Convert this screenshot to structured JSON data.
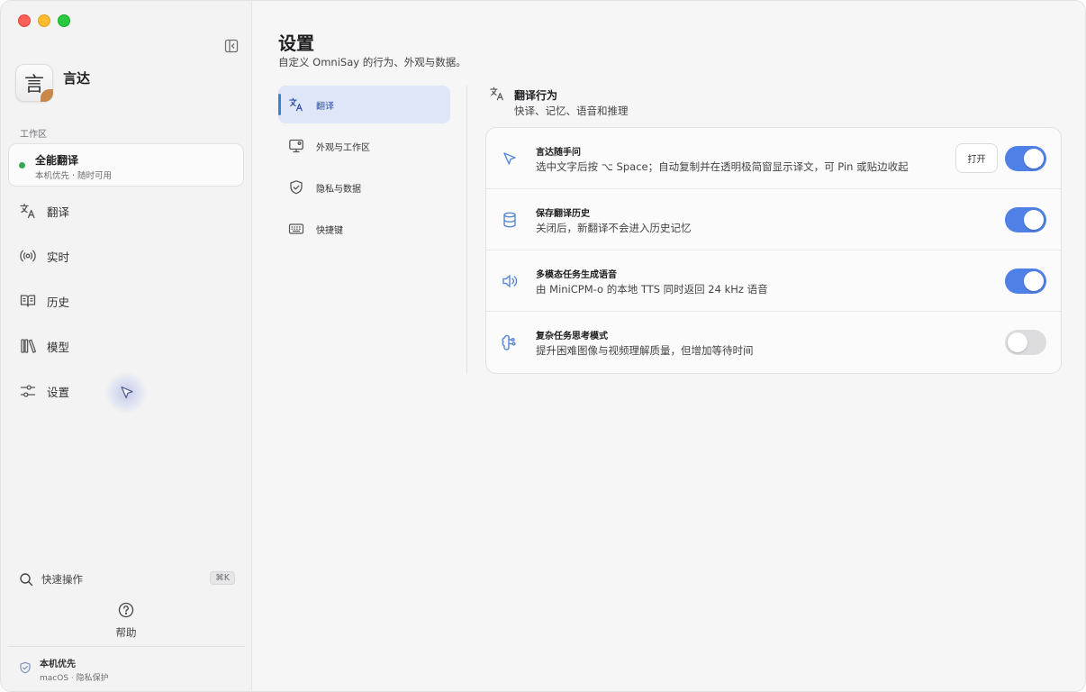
{
  "sidebar": {
    "app_logo_glyph": "言",
    "app_name": "言达",
    "section_label": "工作区",
    "workspace": {
      "title": "全能翻译",
      "subtitle": "本机优先 · 随时可用",
      "status_color": "#34a853"
    },
    "nav_items": [
      {
        "label": "翻译",
        "icon": "translate-icon"
      },
      {
        "label": "实时",
        "icon": "broadcast-icon"
      },
      {
        "label": "历史",
        "icon": "book-icon"
      },
      {
        "label": "模型",
        "icon": "library-icon"
      },
      {
        "label": "设置",
        "icon": "sliders-icon"
      }
    ],
    "quick_action": {
      "label": "快速操作",
      "shortcut": "⌘K"
    },
    "help_label": "帮助",
    "footer": {
      "title": "本机优先",
      "subtitle": "macOS · 隐私保护"
    }
  },
  "main": {
    "title": "设置",
    "subtitle": "自定义 OmniSay 的行为、外观与数据。",
    "subnav": [
      {
        "label": "翻译",
        "icon": "translate-icon",
        "active": true
      },
      {
        "label": "外观与工作区",
        "icon": "monitor-icon",
        "active": false
      },
      {
        "label": "隐私与数据",
        "icon": "shield-icon",
        "active": false
      },
      {
        "label": "快捷键",
        "icon": "keyboard-icon",
        "active": false
      }
    ],
    "section": {
      "title": "翻译行为",
      "subtitle": "快译、记忆、语音和推理"
    },
    "settings": [
      {
        "title": "言达随手问",
        "description": "选中文字后按 ⌥ Space；自动复制并在透明极简窗显示译文，可 Pin 或贴边收起",
        "icon": "cursor-icon",
        "button_label": "打开",
        "enabled": true
      },
      {
        "title": "保存翻译历史",
        "description": "关闭后，新翻译不会进入历史记忆",
        "icon": "database-icon",
        "enabled": true
      },
      {
        "title": "多模态任务生成语音",
        "description": "由 MiniCPM-o 的本地 TTS 同时返回 24 kHz 语音",
        "icon": "speaker-icon",
        "enabled": true
      },
      {
        "title": "复杂任务思考模式",
        "description": "提升困难图像与视频理解质量，但增加等待时间",
        "icon": "brain-icon",
        "enabled": false
      }
    ],
    "accent_color": "#4f80e6"
  }
}
